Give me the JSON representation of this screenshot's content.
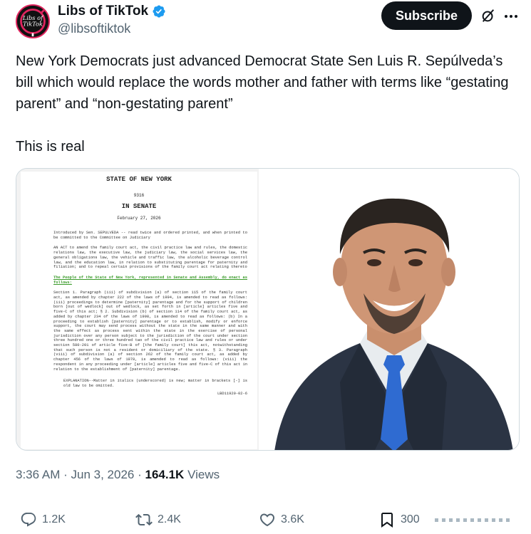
{
  "author": {
    "display_name": "Libs of TikTok",
    "handle": "@libsoftiktok",
    "avatar_text": "Libs of TikTok",
    "verified": true
  },
  "header": {
    "subscribe_label": "Subscribe",
    "grok_icon": "grok-icon",
    "more_icon": "more-icon"
  },
  "tweet": {
    "text": "New York Democrats just advanced Democrat State Sen Luis R. Sepúlveda’s bill which would replace the words mother and father with terms like “gestating parent” and “non-gestating parent”\n\nThis is real"
  },
  "document": {
    "state": "STATE OF NEW YORK",
    "number": "9316",
    "chamber": "IN SENATE",
    "date": "February 27, 2026",
    "intro": "Introduced by Sen. SEPULVEDA -- read twice and ordered printed, and when printed to be committed to the Committee on Judiciary",
    "act": "AN ACT to amend the family court act, the civil practice law and rules, the domestic relations law, the executive law, the judiciary law, the social services law, the general obligations law, the vehicle and traffic law, the alcoholic beverage control law, and the education law, in relation to substituting parentage for paternity and filiation; and to repeal certain provisions of the family court act relating thereto",
    "enacting": "The People of the State of New York, represented in Senate and Assembly, do enact as follows:",
    "body": "Section 1. Paragraph (iii) of subdivision (a) of section 115 of the family court act, as amended by chapter 222 of the laws of 1994, is amended to read as follows: (iii) proceedings to determine [paternity] parentage and for the support of children born [out of wedlock] out of wedlock, as set forth in [article] articles five and five-C of this act; § 2. Subdivision (b) of section 114 of the family court act, as added by chapter 234 of the laws of 1998, is amended to read as follows: (b) In a proceeding to establish [paternity] parentage or to establish, modify or enforce support, the court may send process without the state in the same manner and with the same effect as process sent within the state in the exercise of personal jurisdiction over any person subject to the jurisdiction of the court under section three hundred one or three hundred two of the civil practice law and rules or under section 580-201 of article five-B of [the family court] this act, notwithstanding that such person is not a resident or domiciliary of the state. § 3. Paragraph (viii) of subdivision (a) of section 262 of the family court act, as added by chapter 456 of the laws of 1978, is amended to read as follows: (viii) the respondent in any proceeding under [article] articles five and five-C of this act in relation to the establishment of [paternity] parentage.",
    "explanation": "EXPLANATION--Matter in italics (underscored) is new; matter in brackets [-] is old law to be omitted.",
    "code": "LBD11920-02-6"
  },
  "meta": {
    "time": "3:36 AM",
    "date": "Jun 3, 2026",
    "separator": "·",
    "views_count": "164.1K",
    "views_label": "Views"
  },
  "actions": {
    "replies": "1.2K",
    "reposts": "2.4K",
    "likes": "3.6K",
    "bookmarks": "300"
  },
  "colors": {
    "text": "#0f1419",
    "muted": "#536471",
    "verified_blue": "#1d9bf0",
    "border": "#cfd9de",
    "green_insert": "#3a9b2a",
    "red_strike": "#dd3333"
  }
}
